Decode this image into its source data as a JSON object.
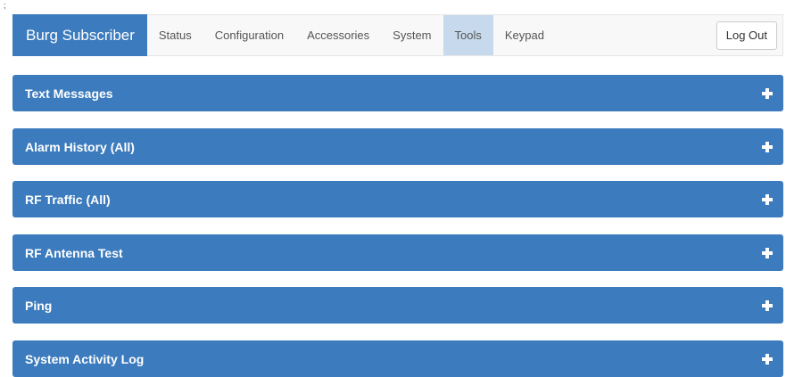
{
  "corner_mark": ";",
  "navbar": {
    "brand": "Burg Subscriber",
    "items": [
      {
        "label": "Status",
        "active": false
      },
      {
        "label": "Configuration",
        "active": false
      },
      {
        "label": "Accessories",
        "active": false
      },
      {
        "label": "System",
        "active": false
      },
      {
        "label": "Tools",
        "active": true
      },
      {
        "label": "Keypad",
        "active": false
      }
    ],
    "logout_label": "Log Out"
  },
  "panels": [
    {
      "title": "Text Messages",
      "icon": "plus-icon"
    },
    {
      "title": "Alarm History (All)",
      "icon": "plus-icon"
    },
    {
      "title": "RF Traffic (All)",
      "icon": "plus-icon"
    },
    {
      "title": "RF Antenna Test",
      "icon": "plus-icon"
    },
    {
      "title": "Ping",
      "icon": "plus-icon"
    },
    {
      "title": "System Activity Log",
      "icon": "plus-icon"
    }
  ],
  "colors": {
    "brand": "#3c7bbd",
    "panel": "#3c7bbd",
    "active_tab": "#c7d9ec",
    "navbar_bg": "#f8f8f8"
  }
}
